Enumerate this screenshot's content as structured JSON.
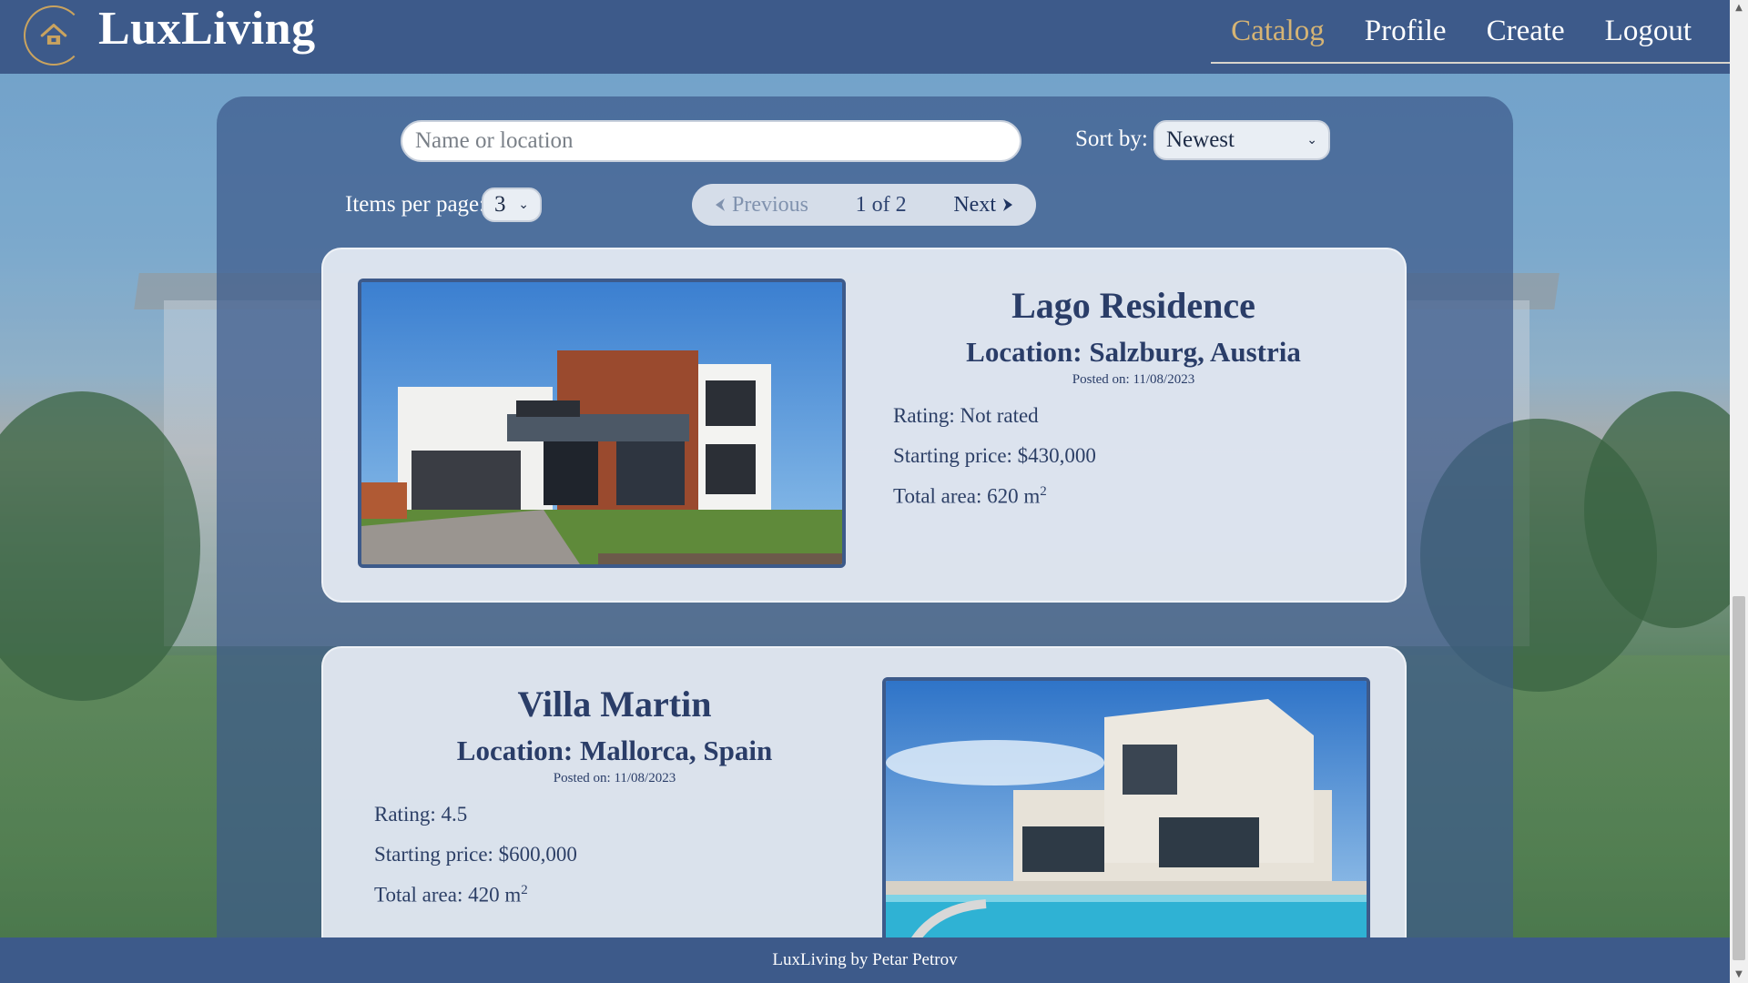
{
  "header": {
    "brand": "LuxLiving",
    "logo_icon": "house-logo-icon",
    "nav": [
      {
        "label": "Catalog",
        "active": true
      },
      {
        "label": "Profile",
        "active": false
      },
      {
        "label": "Create",
        "active": false
      },
      {
        "label": "Logout",
        "active": false
      }
    ]
  },
  "filters": {
    "search_placeholder": "Name or location",
    "search_value": "",
    "sort_label": "Sort by:",
    "sort_value": "Newest",
    "items_per_page_label": "Items per page:",
    "items_per_page_value": "3"
  },
  "pager": {
    "prev_label": "Previous",
    "page_text": "1 of 2",
    "next_label": "Next"
  },
  "listings": [
    {
      "name": "Lago Residence",
      "location": "Location: Salzburg, Austria",
      "posted": "Posted on: 11/08/2023",
      "rating": "Rating: Not rated",
      "price": "Starting price: $430,000",
      "area": "Total area: 620 m",
      "area_sup": "2"
    },
    {
      "name": "Villa Martin",
      "location": "Location: Mallorca, Spain",
      "posted": "Posted on: 11/08/2023",
      "rating": "Rating: 4.5",
      "price": "Starting price: $600,000",
      "area": "Total area: 420 m",
      "area_sup": "2"
    }
  ],
  "footer": {
    "text": "LuxLiving by Petar Petrov"
  },
  "colors": {
    "header": "#3d5a8a",
    "accent": "#d6b474",
    "card": "#e6ecf4",
    "text_dark": "#2a3d68"
  }
}
